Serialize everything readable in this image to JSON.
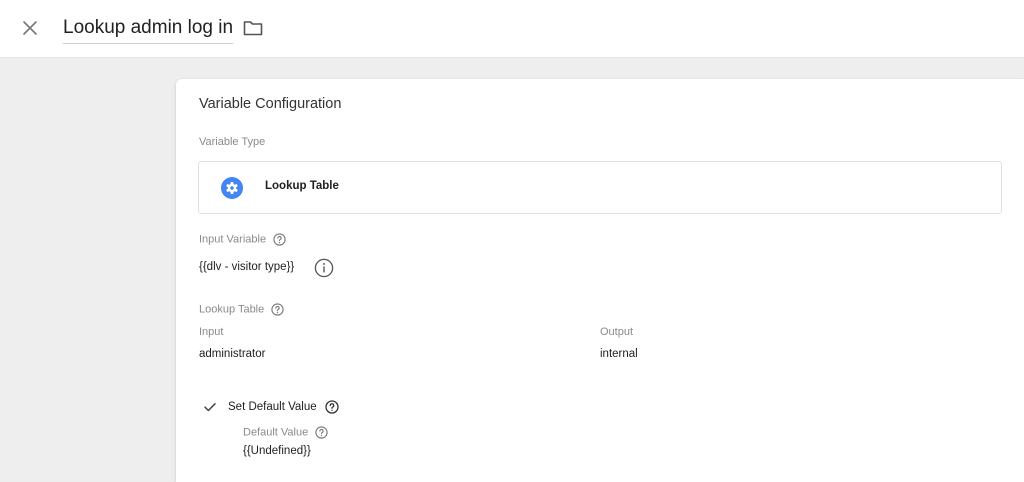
{
  "header": {
    "title": "Lookup admin log in",
    "close_icon": "close-icon",
    "folder_icon": "folder-icon"
  },
  "config": {
    "section_title": "Variable Configuration",
    "variable_type_label": "Variable Type",
    "variable_type_value": "Lookup Table",
    "variable_type_icon": "gear-icon",
    "accent_color": "#4285f4",
    "input_variable_label": "Input Variable",
    "input_variable_value": "{{dlv - visitor type}}",
    "lookup_table_label": "Lookup Table",
    "table": {
      "columns": [
        "Input",
        "Output"
      ],
      "rows": [
        [
          "administrator",
          "internal"
        ]
      ]
    },
    "default": {
      "label": "Set Default Value",
      "checked": true,
      "value_label": "Default Value",
      "value": "{{Undefined}}"
    }
  }
}
